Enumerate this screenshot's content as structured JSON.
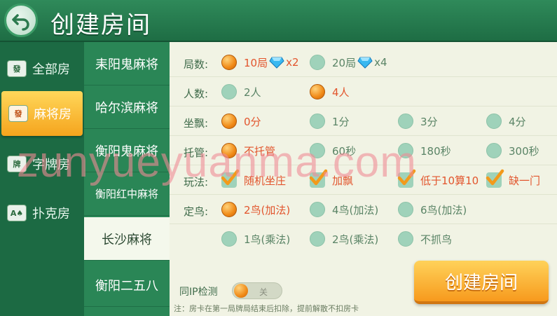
{
  "header": {
    "title": "创建房间"
  },
  "categories": [
    {
      "label": "全部房",
      "icon": "mahjong-tile-icon"
    },
    {
      "label": "麻将房",
      "icon": "mahjong-tile-icon"
    },
    {
      "label": "字牌房",
      "icon": "cards-icon"
    },
    {
      "label": "扑克房",
      "icon": "poker-card-icon"
    }
  ],
  "games": [
    "耒阳鬼麻将",
    "哈尔滨麻将",
    "衡阳鬼麻将",
    "衡阳红中麻将",
    "长沙麻将",
    "衡阳二五八"
  ],
  "rows": {
    "rounds": {
      "label": "局数:",
      "opts": [
        {
          "text": "10局",
          "suffix": "x2",
          "selected": true
        },
        {
          "text": "20局",
          "suffix": "x4",
          "selected": false
        }
      ]
    },
    "players": {
      "label": "人数:",
      "opts": [
        {
          "text": "2人",
          "selected": false
        },
        {
          "text": "4人",
          "selected": true
        }
      ]
    },
    "piao": {
      "label": "坐飘:",
      "opts": [
        {
          "text": "0分",
          "selected": true
        },
        {
          "text": "1分",
          "selected": false
        },
        {
          "text": "3分",
          "selected": false
        },
        {
          "text": "4分",
          "selected": false
        }
      ]
    },
    "auto": {
      "label": "托管:",
      "opts": [
        {
          "text": "不托管",
          "selected": true
        },
        {
          "text": "60秒",
          "selected": false
        },
        {
          "text": "180秒",
          "selected": false
        },
        {
          "text": "300秒",
          "selected": false
        }
      ]
    },
    "rules": {
      "label": "玩法:",
      "opts": [
        {
          "text": "随机坐庄",
          "checked": true
        },
        {
          "text": "加飘",
          "checked": true
        },
        {
          "text": "低于10算10",
          "checked": true
        },
        {
          "text": "缺一门",
          "checked": true
        }
      ]
    },
    "birds": {
      "label": "定鸟:",
      "opts": [
        {
          "text": "2鸟(加法)",
          "selected": true
        },
        {
          "text": "4鸟(加法)",
          "selected": false
        },
        {
          "text": "6鸟(加法)",
          "selected": false
        },
        {
          "text": "1鸟(乘法)",
          "selected": false
        },
        {
          "text": "2鸟(乘法)",
          "selected": false
        },
        {
          "text": "不抓鸟",
          "selected": false
        }
      ]
    }
  },
  "ip_check": {
    "label": "同IP检测",
    "state": "关"
  },
  "note": "注：房卡在第一局牌局结束后扣除，提前解散不扣房卡",
  "create_button": "创建房间",
  "watermark": "zunyueyuanma.com",
  "colors": {
    "selected_text": "#e2552d",
    "accent_orange": "#f79a1d",
    "header_green": "#2f8a5a"
  }
}
